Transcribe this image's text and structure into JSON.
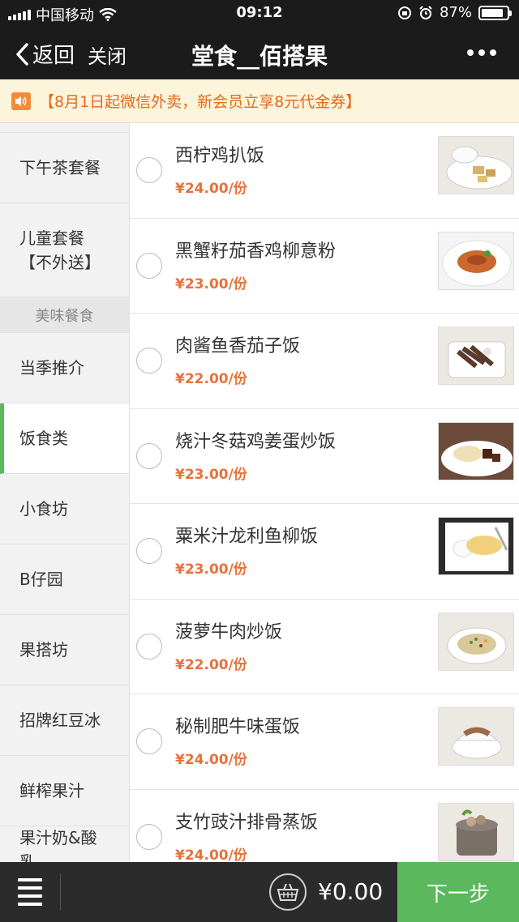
{
  "status_bar": {
    "carrier": "中国移动",
    "time": "09:12",
    "battery": "87%",
    "battery_level": 0.87
  },
  "nav": {
    "back_label": "返回",
    "close_label": "关闭",
    "title": "堂食__佰搭果"
  },
  "notice": {
    "text": "【8月1日起微信外卖，新会员立享8元代金券】"
  },
  "sidebar": {
    "items": [
      {
        "label": "下午茶套餐"
      },
      {
        "label": "儿童套餐【不外送】"
      },
      {
        "section": "美味餐食"
      },
      {
        "label": "当季推介"
      },
      {
        "label": "饭食类",
        "active": true
      },
      {
        "label": "小食坊"
      },
      {
        "label": "B仔园"
      },
      {
        "label": "果搭坊"
      },
      {
        "label": "招牌红豆冰"
      },
      {
        "label": "鲜榨果汁"
      },
      {
        "label": "果汁奶&酸乳"
      }
    ]
  },
  "dishes": [
    {
      "name": "西柠鸡扒饭",
      "price": "¥24.00/份"
    },
    {
      "name": "黑蟹籽茄香鸡柳意粉",
      "price": "¥23.00/份"
    },
    {
      "name": "肉酱鱼香茄子饭",
      "price": "¥22.00/份"
    },
    {
      "name": "烧汁冬菇鸡姜蛋炒饭",
      "price": "¥23.00/份"
    },
    {
      "name": "粟米汁龙利鱼柳饭",
      "price": "¥23.00/份"
    },
    {
      "name": "菠萝牛肉炒饭",
      "price": "¥22.00/份"
    },
    {
      "name": "秘制肥牛味蛋饭",
      "price": "¥24.00/份"
    },
    {
      "name": "支竹豉汁排骨蒸饭",
      "price": "¥24.00/份"
    }
  ],
  "bottom": {
    "total": "¥0.00",
    "next_label": "下一步"
  },
  "colors": {
    "accent_green": "#5cb85c",
    "price_orange": "#e8703a",
    "notice_bg": "#fdf4dc",
    "bar_dark": "#1b1b1b"
  }
}
